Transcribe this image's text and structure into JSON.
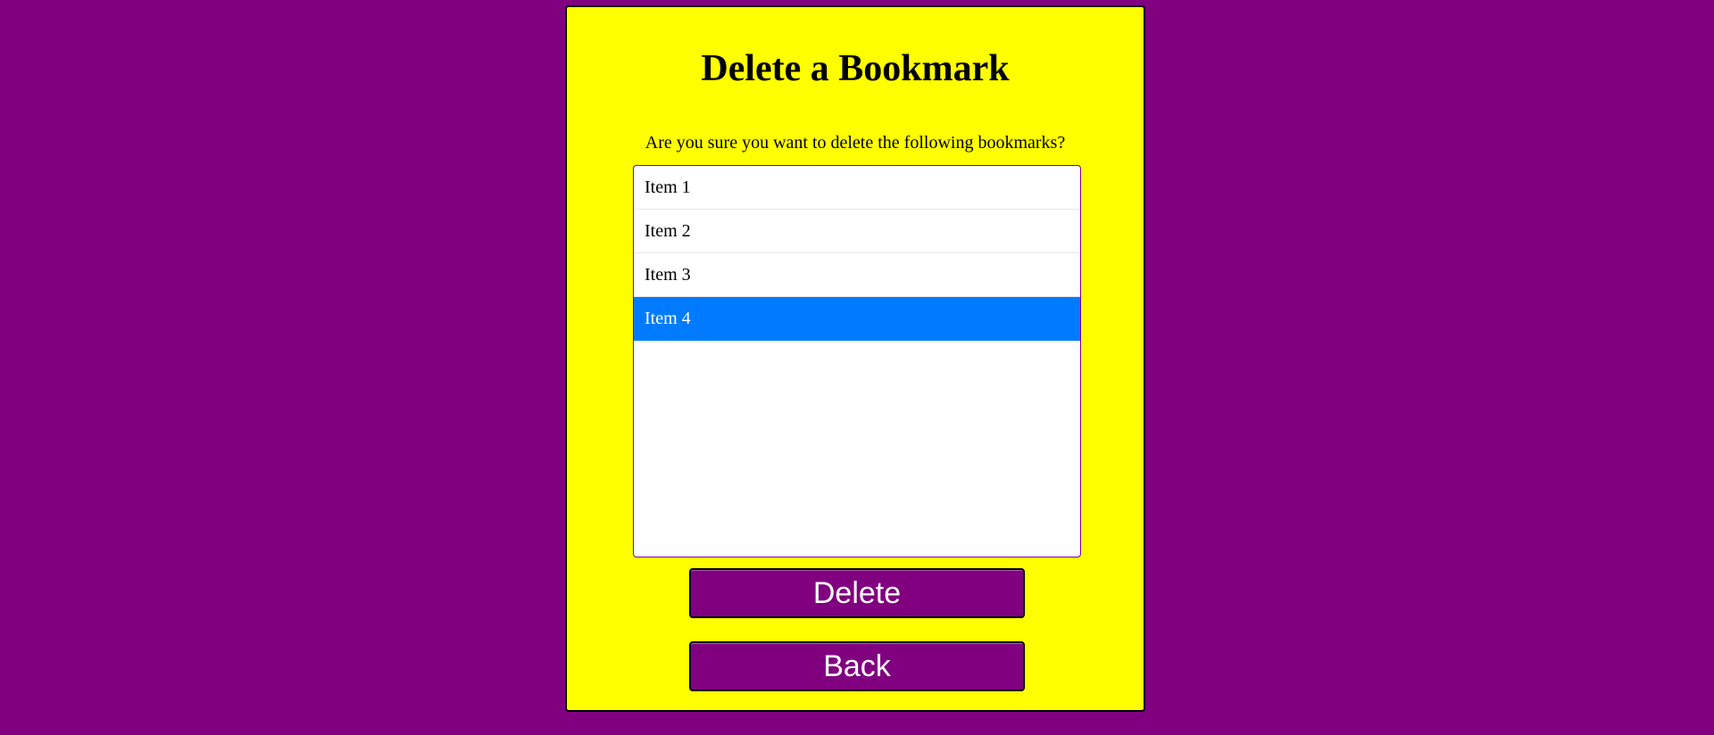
{
  "page": {
    "title": "Delete a Bookmark",
    "question": "Are you sure you want to delete the following bookmarks?"
  },
  "bookmarks": {
    "items": [
      {
        "label": "Item 1",
        "selected": false
      },
      {
        "label": "Item 2",
        "selected": false
      },
      {
        "label": "Item 3",
        "selected": false
      },
      {
        "label": "Item 4",
        "selected": true
      }
    ]
  },
  "actions": {
    "delete_label": "Delete",
    "back_label": "Back"
  },
  "colors": {
    "background": "#800080",
    "panel": "#ffff00",
    "selection": "#007bff",
    "button": "#800080"
  }
}
